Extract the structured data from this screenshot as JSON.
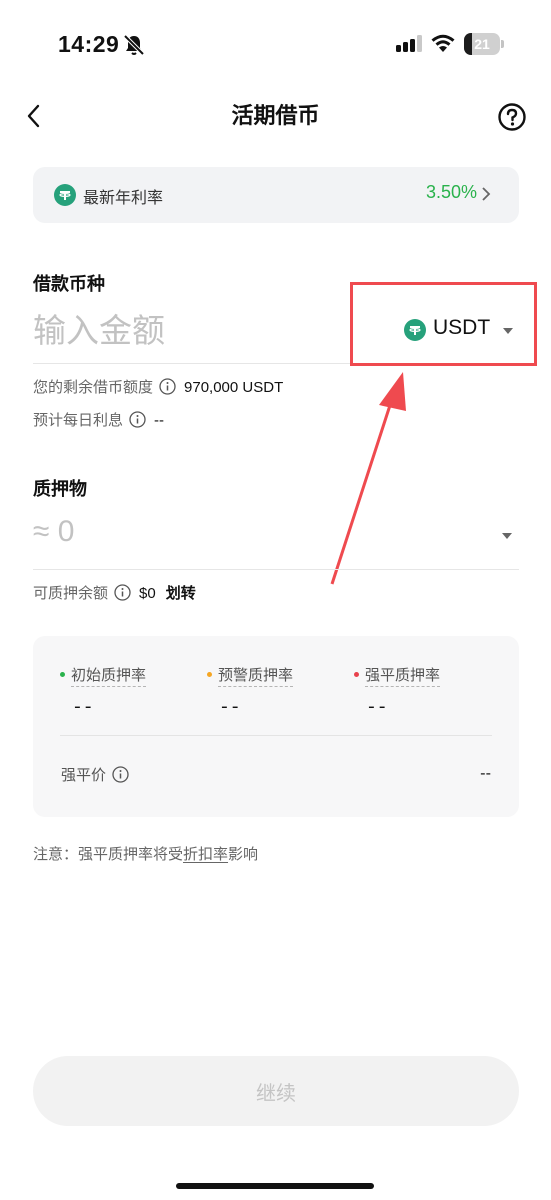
{
  "status_bar": {
    "time": "14:29",
    "battery": "21",
    "battery_level": 0.21
  },
  "nav": {
    "title": "活期借币"
  },
  "rate_banner": {
    "label": "最新年利率",
    "value": "3.50%"
  },
  "borrow": {
    "section_label": "借款币种",
    "amount_placeholder": "输入金额",
    "currency": "USDT",
    "remaining_label": "您的剩余借币额度",
    "remaining_value": "970,000 USDT",
    "daily_interest_label": "预计每日利息",
    "daily_interest_value": "--"
  },
  "collateral": {
    "section_label": "质押物",
    "amount": "≈ 0",
    "available_label": "可质押余额",
    "available_value": "$0",
    "transfer_label": "划转"
  },
  "ratios": {
    "items": [
      {
        "label": "初始质押率",
        "value": "--",
        "color": "#2ab24c"
      },
      {
        "label": "预警质押率",
        "value": "--",
        "color": "#f5a623"
      },
      {
        "label": "强平质押率",
        "value": "--",
        "color": "#e8414c"
      }
    ],
    "liquidation_label": "强平价",
    "liquidation_value": "--"
  },
  "note": {
    "prefix": "注意：强平质押率将受",
    "link": "折扣率",
    "suffix": "影响"
  },
  "continue_button": "继续",
  "colors": {
    "accent_green": "#2ab24c",
    "usdt": "#26a17b",
    "annotation_red": "#ef4a4f"
  }
}
